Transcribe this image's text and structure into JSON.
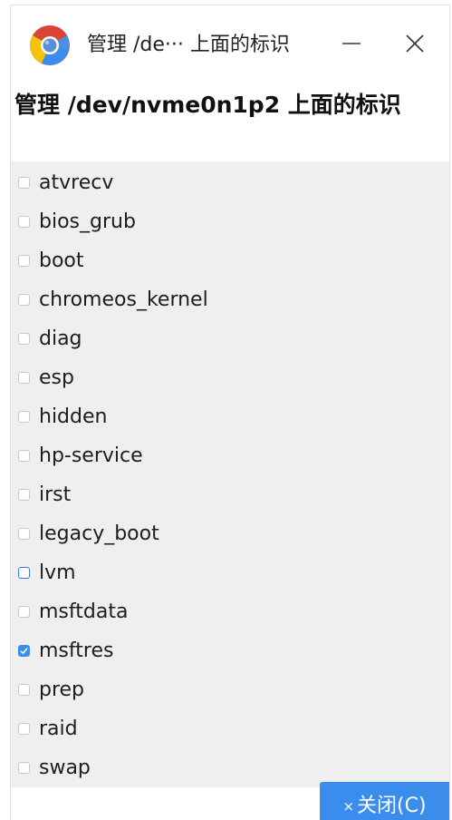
{
  "window": {
    "title": "管理 /de··· 上面的标识",
    "app_icon": "chrome-like-app-icon",
    "minimize_icon": "minimize-icon",
    "close_icon": "close-icon"
  },
  "dialog": {
    "heading": "管理 /dev/nvme0n1p2 上面的标识"
  },
  "flags": [
    {
      "label": "atvrecv",
      "checked": false,
      "focused": false
    },
    {
      "label": "bios_grub",
      "checked": false,
      "focused": false
    },
    {
      "label": "boot",
      "checked": false,
      "focused": false
    },
    {
      "label": "chromeos_kernel",
      "checked": false,
      "focused": false
    },
    {
      "label": "diag",
      "checked": false,
      "focused": false
    },
    {
      "label": "esp",
      "checked": false,
      "focused": false
    },
    {
      "label": "hidden",
      "checked": false,
      "focused": false
    },
    {
      "label": "hp-service",
      "checked": false,
      "focused": false
    },
    {
      "label": "irst",
      "checked": false,
      "focused": false
    },
    {
      "label": "legacy_boot",
      "checked": false,
      "focused": false
    },
    {
      "label": "lvm",
      "checked": false,
      "focused": true
    },
    {
      "label": "msftdata",
      "checked": false,
      "focused": false
    },
    {
      "label": "msftres",
      "checked": true,
      "focused": false
    },
    {
      "label": "prep",
      "checked": false,
      "focused": false
    },
    {
      "label": "raid",
      "checked": false,
      "focused": false
    },
    {
      "label": "swap",
      "checked": false,
      "focused": false
    }
  ],
  "footer": {
    "close_label": "关闭(C)",
    "close_icon_glyph": "×"
  },
  "colors": {
    "accent": "#3b8ded",
    "list_background": "#efefef"
  }
}
